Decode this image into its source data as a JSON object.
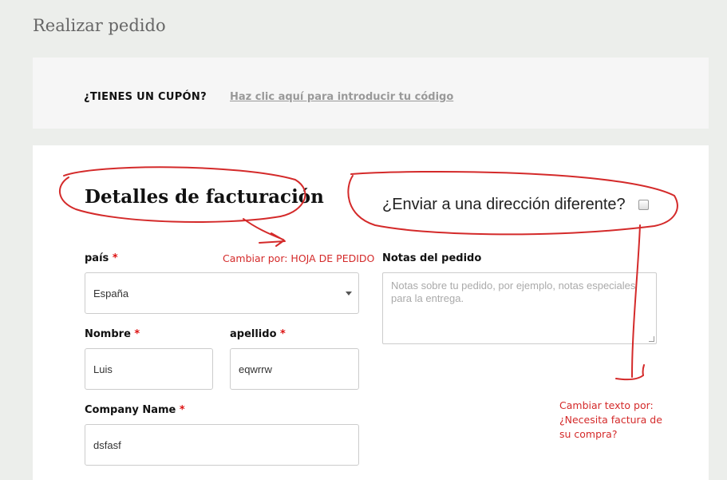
{
  "page": {
    "title": "Realizar pedido"
  },
  "coupon": {
    "label": "¿TIENES UN CUPÓN?",
    "link": "Haz clic aquí para introducir tu código"
  },
  "billing": {
    "title": "Detalles de facturación",
    "country": {
      "label": "país",
      "required_mark": "*",
      "value": "España"
    },
    "first_name": {
      "label": "Nombre",
      "required_mark": "*",
      "value": "Luis"
    },
    "last_name": {
      "label": "apellido",
      "required_mark": "*",
      "value": "eqwrrw"
    },
    "company": {
      "label": "Company Name",
      "required_mark": "*",
      "value": "dsfasf"
    }
  },
  "shipping": {
    "different_address_label": "¿Enviar a una dirección diferente?",
    "checked": false
  },
  "order_notes": {
    "label": "Notas del pedido",
    "placeholder": "Notas sobre tu pedido, por ejemplo, notas especiales para la entrega."
  },
  "annotations": {
    "billing_note": "Cambiar por: HOJA DE PEDIDO",
    "shipping_note_1": "Cambiar texto por:",
    "shipping_note_2": "¿Necesita factura de",
    "shipping_note_3": "su compra?",
    "color": "#d42a2a"
  },
  "colors": {
    "background": "#eceeeb",
    "panel": "#ffffff",
    "required": "#dd1111"
  }
}
